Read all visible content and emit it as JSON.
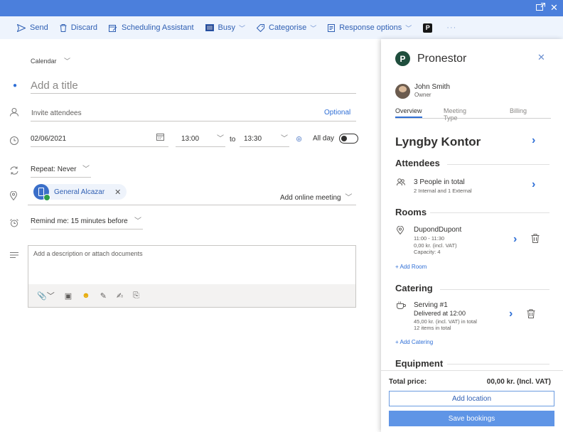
{
  "toolbar": {
    "send": "Send",
    "discard": "Discard",
    "scheduling": "Scheduling Assistant",
    "busy": "Busy",
    "categorise": "Categorise",
    "response": "Response options",
    "more": "···"
  },
  "form": {
    "calendar": "Calendar",
    "title_placeholder": "Add a title",
    "attendees_placeholder": "Invite attendees",
    "optional": "Optional",
    "date": "02/06/2021",
    "start_time": "13:00",
    "to": "to",
    "end_time": "13:30",
    "all_day": "All day",
    "repeat": "Repeat:  Never",
    "location_chip": "General Alcazar",
    "online_meeting": "Add online meeting",
    "reminder": "Remind me:  15 minutes before",
    "description_placeholder": "Add a description or attach documents"
  },
  "pane": {
    "title": "Pronestor",
    "user_name": "John Smith",
    "user_role": "Owner",
    "tabs": [
      "Overview",
      "Meeting Type",
      "Billing"
    ],
    "office": "Lyngby Kontor",
    "attendees": {
      "heading": "Attendees",
      "summary": "3 People in total",
      "detail": "2 Internal and 1 External"
    },
    "rooms": {
      "heading": "Rooms",
      "name": "DupondDupont",
      "time": "11:00 - 11:30",
      "price": "0,00 kr. (incl. VAT)",
      "capacity": "Capacity: 4",
      "add": "+ Add Room"
    },
    "catering": {
      "heading": "Catering",
      "name": "Serving #1",
      "delivered": "Delivered at 12:00",
      "price": "45,00 kr. (incl. VAT) in total",
      "items": "12 items in total",
      "add": "+ Add Catering"
    },
    "equipment": {
      "heading": "Equipment"
    },
    "footer": {
      "total_label": "Total price:",
      "total_value": "00,00 kr. (Incl. VAT)",
      "add_location": "Add location",
      "save": "Save bookings"
    }
  },
  "colors": {
    "titlebar": "#4b7fdc",
    "accent": "#2f6fd6",
    "brand_logo": "#1f4e3d",
    "primary_button": "#5f95e6"
  }
}
